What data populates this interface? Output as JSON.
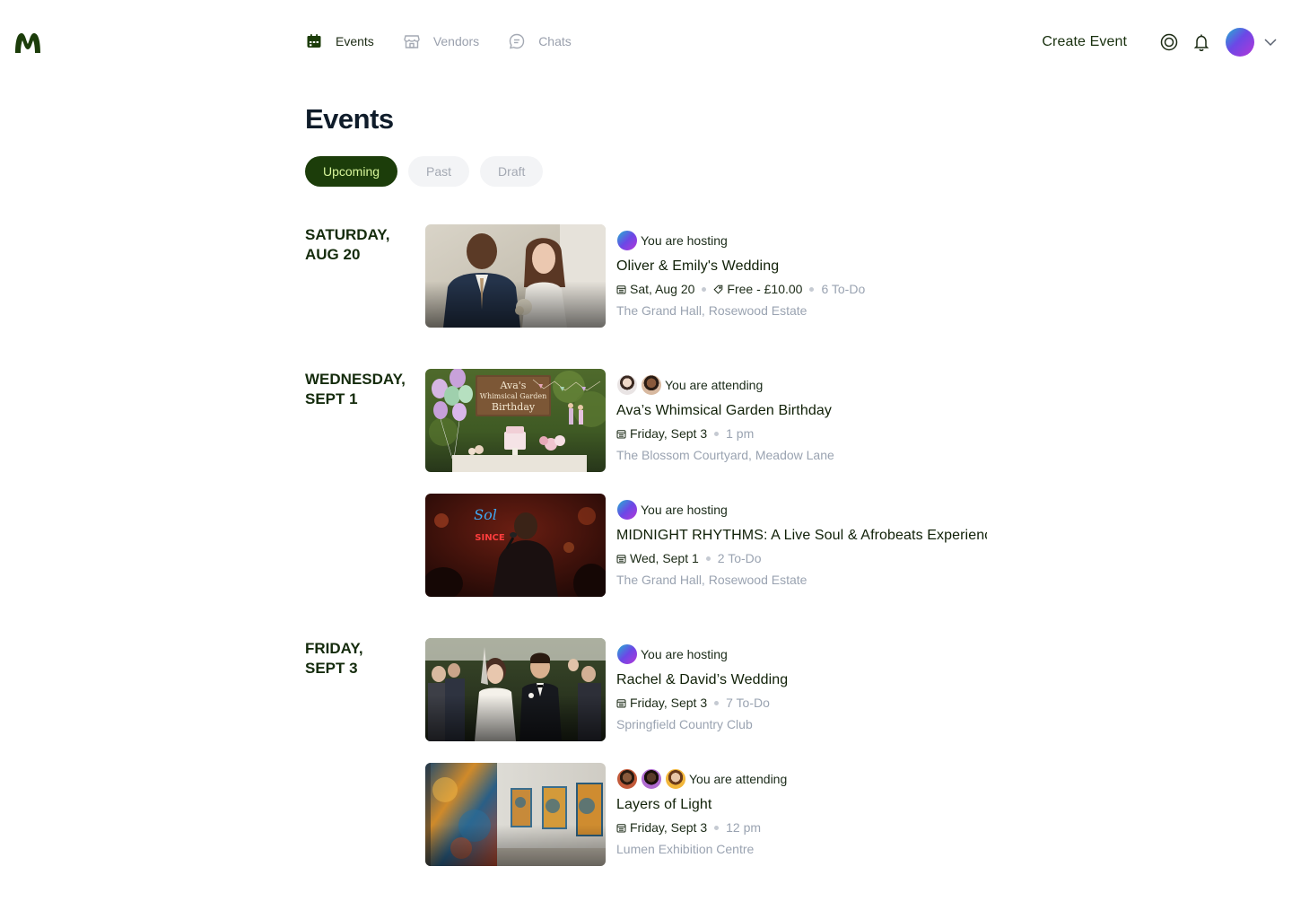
{
  "nav": {
    "items": [
      {
        "label": "Events",
        "icon": "calendar-icon",
        "active": true
      },
      {
        "label": "Vendors",
        "icon": "store-icon",
        "active": false
      },
      {
        "label": "Chats",
        "icon": "chat-icon",
        "active": false
      }
    ]
  },
  "header": {
    "create_label": "Create Event"
  },
  "page": {
    "title": "Events",
    "tabs": [
      {
        "label": "Upcoming",
        "active": true
      },
      {
        "label": "Past",
        "active": false
      },
      {
        "label": "Draft",
        "active": false
      }
    ]
  },
  "groups": [
    {
      "date_line1": "SATURDAY,",
      "date_line2": "AUG 20"
    },
    {
      "date_line1": "WEDNESDAY,",
      "date_line2": "SEPT 1"
    },
    {
      "date_line1": "FRIDAY,",
      "date_line2": "SEPT 3"
    }
  ],
  "events": [
    {
      "role": "You are hosting",
      "title": "Oliver & Emily's Wedding",
      "date": "Sat, Aug 20",
      "price": "Free - £10.00",
      "todo": "6 To-Do",
      "venue": "The Grand Hall, Rosewood Estate"
    },
    {
      "role": "You are attending",
      "title": "Ava’s Whimsical Garden Birthday",
      "date": "Friday, Sept 3",
      "time": "1 pm",
      "venue": "The Blossom Courtyard, Meadow Lane",
      "sign_line1": "Ava's",
      "sign_line2": "Whimsical Garden",
      "sign_line3": "Birthday"
    },
    {
      "role": "You are hosting",
      "title": "MIDNIGHT RHYTHMS: A Live Soul & Afrobeats Experience",
      "date": "Wed, Sept 1",
      "todo": "2 To-Do",
      "venue": "The Grand Hall, Rosewood Estate"
    },
    {
      "role": "You are hosting",
      "title": "Rachel & David’s Wedding",
      "date": "Friday, Sept 3",
      "todo": "7 To-Do",
      "venue": "Springfield Country Club"
    },
    {
      "role": "You are attending",
      "title": "Layers of Light",
      "date": "Friday, Sept 3",
      "time": "12 pm",
      "venue": "Lumen Exhibition Centre"
    }
  ],
  "colors": {
    "brand_dark": "#1c3d0a",
    "brand_light": "#d7f59a",
    "muted": "#9aa3b1"
  }
}
